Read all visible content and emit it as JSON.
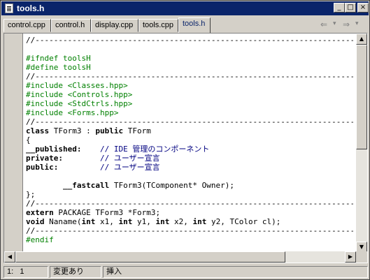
{
  "window": {
    "title": "tools.h"
  },
  "caption_buttons": {
    "minimize": "_",
    "maximize": "□",
    "close": "×"
  },
  "tabs": [
    {
      "label": "control.cpp"
    },
    {
      "label": "control.h"
    },
    {
      "label": "display.cpp"
    },
    {
      "label": "tools.cpp"
    },
    {
      "label": "tools.h",
      "active": true
    }
  ],
  "nav": {
    "back": "⇐",
    "back_dropdown": "▾",
    "forward": "⇒",
    "forward_dropdown": "▾"
  },
  "editor": {
    "lines": [
      "//---------------------------------------------------------------------------",
      "",
      "#ifndef toolsH",
      "#define toolsH",
      "//---------------------------------------------------------------------------",
      "#include <Classes.hpp>",
      "#include <Controls.hpp>",
      "#include <StdCtrls.hpp>",
      "#include <Forms.hpp>",
      "//---------------------------------------------------------------------------",
      {
        "kw1": "class",
        "t1": " TForm3 : ",
        "kw2": "public",
        "t2": " TForm"
      },
      "{",
      {
        "kw": "__published:",
        "sp": "    ",
        "comment": "// IDE 管理のコンポーネント"
      },
      {
        "kw": "private:",
        "sp": "        ",
        "comment": "// ユーザー宣言"
      },
      {
        "kw": "public:",
        "sp": "         ",
        "comment": "// ユーザー宣言"
      },
      "",
      {
        "indent": "        ",
        "kw": "__fastcall",
        "text": " TForm3(TComponent* Owner);"
      },
      "};",
      "//---------------------------------------------------------------------------",
      {
        "kw": "extern",
        "text": " PACKAGE TForm3 *Form3;"
      },
      {
        "void": "void",
        "a": " Naname(",
        "i1": "int",
        "b": " x1, ",
        "i2": "int",
        "c": " y1, ",
        "i3": "int",
        "d": " x2, ",
        "i4": "int",
        "e": " y2, TColor cl);"
      },
      "//---------------------------------------------------------------------------",
      "#endif"
    ]
  },
  "scrollbars": {
    "up": "▲",
    "down": "▼",
    "left": "◀",
    "right": "▶"
  },
  "status": {
    "position": "1:   1",
    "modified": "変更あり",
    "mode": "挿入"
  }
}
